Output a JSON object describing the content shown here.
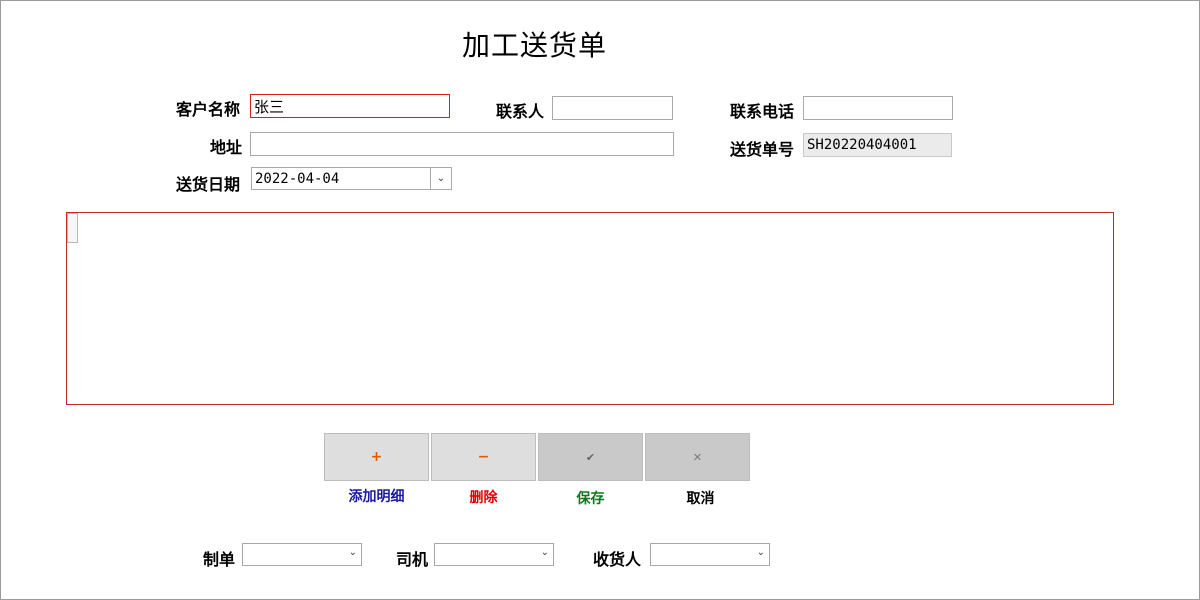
{
  "title": "加工送货单",
  "form": {
    "customer_label": "客户名称",
    "customer_value": "张三",
    "contact_label": "联系人",
    "contact_value": "",
    "phone_label": "联系电话",
    "phone_value": "",
    "address_label": "地址",
    "address_value": "",
    "order_no_label": "送货单号",
    "order_no_value": "SH20220404001",
    "date_label": "送货日期",
    "date_value": "2022-04-04"
  },
  "actions": {
    "add_label": "添加明细",
    "add_symbol": "+",
    "delete_label": "删除",
    "delete_symbol": "−",
    "save_label": "保存",
    "save_symbol": "✔",
    "cancel_label": "取消",
    "cancel_symbol": "✕"
  },
  "footer": {
    "maker_label": "制单",
    "maker_value": "",
    "driver_label": "司机",
    "driver_value": "",
    "receiver_label": "收货人",
    "receiver_value": ""
  },
  "colors": {
    "add_text": "#1a1aa0",
    "delete_text": "#e00000",
    "save_text": "#0a7a1a",
    "cancel_text": "#000000",
    "plus_icon": "#e05a00",
    "minus_icon": "#e05a00",
    "check_icon": "#666666",
    "cross_icon": "#777777",
    "highlight_border": "#d02020"
  }
}
